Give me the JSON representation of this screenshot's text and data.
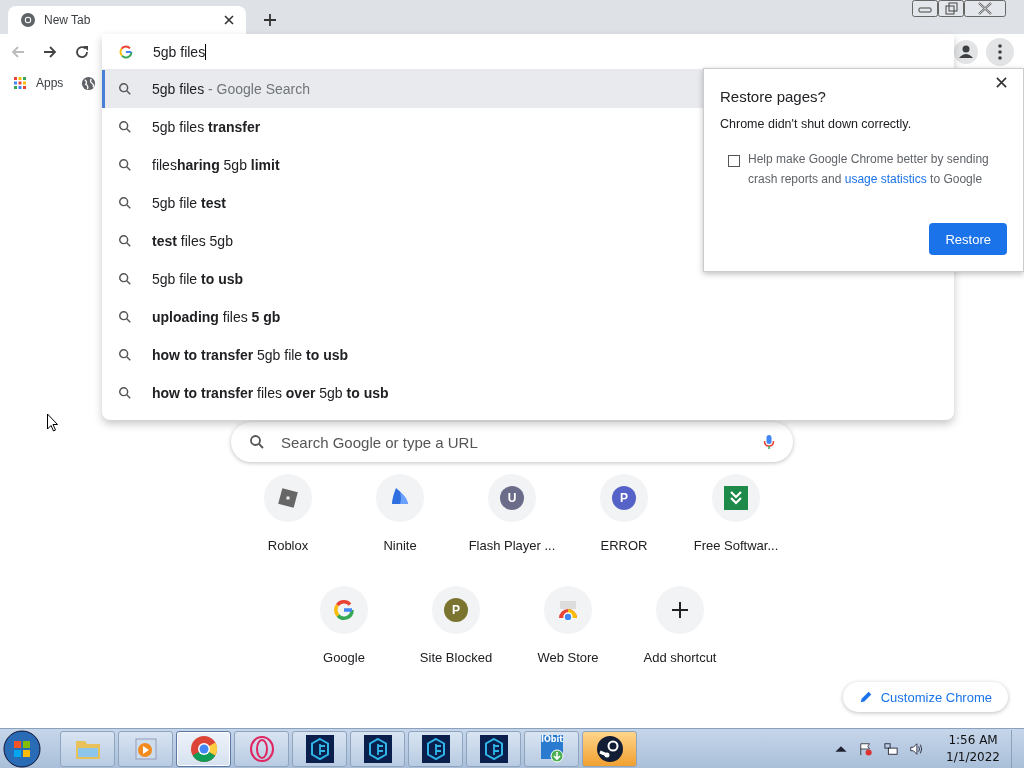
{
  "window": {
    "tab": {
      "title": "New Tab",
      "selected": true
    }
  },
  "toolbar": {
    "address_value": "5gb files"
  },
  "bookmarks": {
    "apps_label": "Apps"
  },
  "suggestions": [
    {
      "text": "5gb files",
      "suffix": " - Google Search",
      "selected": true
    },
    {
      "text": "5gb files **transfer**",
      "selected": false
    },
    {
      "text": "files**haring** 5gb **limit**",
      "selected": false
    },
    {
      "text": "5gb file **test**",
      "selected": false
    },
    {
      "text": "**test** files 5gb",
      "selected": false
    },
    {
      "text": "5gb file **to usb**",
      "selected": false
    },
    {
      "text": "**uploading** files **5 gb**",
      "selected": false
    },
    {
      "text": "**how to transfer** 5gb file **to usb**",
      "selected": false
    },
    {
      "text": "**how to transfer** files **over** 5gb **to usb**",
      "selected": false
    }
  ],
  "restore_dialog": {
    "title": "Restore pages?",
    "message": "Chrome didn't shut down correctly.",
    "checkbox": {
      "checked": false,
      "text_before": "Help make Google Chrome better by sending crash reports and ",
      "link": "usage statistics",
      "text_after": " to Google"
    },
    "button": "Restore"
  },
  "new_tab": {
    "search_placeholder": "Search Google or type a URL",
    "shortcut_rows": [
      [
        {
          "label": "Roblox",
          "kind": "roblox"
        },
        {
          "label": "Ninite",
          "kind": "ninite"
        },
        {
          "label": "Flash Player ...",
          "kind": "letter",
          "letter": "U",
          "color": "#6b6b8a"
        },
        {
          "label": "ERROR",
          "kind": "letter",
          "letter": "P",
          "color": "#5563c8"
        },
        {
          "label": "Free Softwar...",
          "kind": "download"
        }
      ],
      [
        {
          "label": "Google",
          "kind": "google"
        },
        {
          "label": "Site Blocked",
          "kind": "letter",
          "letter": "P",
          "color": "#7a7430"
        },
        {
          "label": "Web Store",
          "kind": "webstore"
        },
        {
          "label": "Add shortcut",
          "kind": "add"
        }
      ]
    ],
    "customize_button": "Customize Chrome"
  },
  "taskbar": {
    "buttons": [
      {
        "kind": "explorer",
        "selected": false,
        "flashing": false
      },
      {
        "kind": "media",
        "selected": false,
        "flashing": false
      },
      {
        "kind": "chrome",
        "selected": true,
        "flashing": false
      },
      {
        "kind": "opera",
        "selected": false,
        "flashing": false
      },
      {
        "kind": "cube",
        "selected": false,
        "flashing": false
      },
      {
        "kind": "cube",
        "selected": false,
        "flashing": false
      },
      {
        "kind": "cube",
        "selected": false,
        "flashing": false
      },
      {
        "kind": "cube",
        "selected": false,
        "flashing": false
      },
      {
        "kind": "iobit",
        "selected": false,
        "flashing": false
      },
      {
        "kind": "steam",
        "selected": false,
        "flashing": true
      }
    ],
    "iobit_label": "IObit",
    "time": "1:56 AM",
    "date": "1/1/2022"
  }
}
